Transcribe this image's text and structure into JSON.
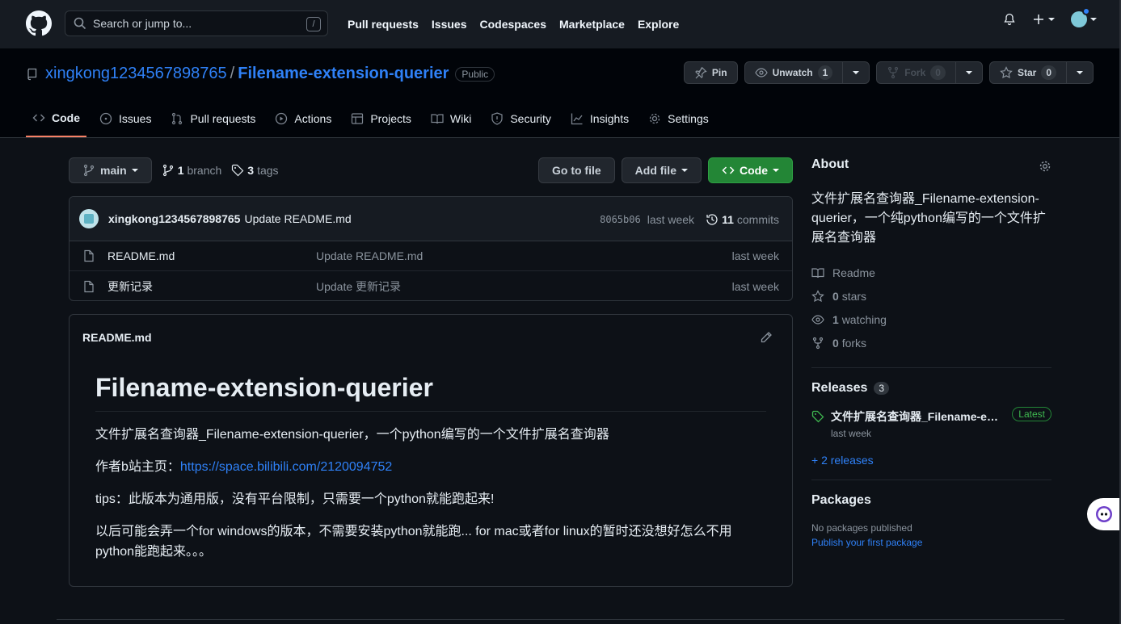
{
  "header": {
    "search_placeholder": "Search or jump to...",
    "search_shortcut": "/",
    "nav": [
      "Pull requests",
      "Issues",
      "Codespaces",
      "Marketplace",
      "Explore"
    ]
  },
  "repo": {
    "owner": "xingkong1234567898765",
    "separator": "/",
    "name": "Filename-extension-querier",
    "visibility": "Public",
    "actions": {
      "pin": "Pin",
      "unwatch": "Unwatch",
      "watch_count": "1",
      "fork": "Fork",
      "fork_count": "0",
      "star": "Star",
      "star_count": "0"
    },
    "tabs": [
      "Code",
      "Issues",
      "Pull requests",
      "Actions",
      "Projects",
      "Wiki",
      "Security",
      "Insights",
      "Settings"
    ]
  },
  "branchbar": {
    "branch": "main",
    "branch_count": "1",
    "branch_label": "branch",
    "tag_count": "3",
    "tag_label": "tags",
    "go_to_file": "Go to file",
    "add_file": "Add file",
    "code": "Code"
  },
  "commit": {
    "author": "xingkong1234567898765",
    "message": "Update README.md",
    "sha": "8065b06",
    "time": "last week",
    "commit_count": "11",
    "commit_label": "commits"
  },
  "files": [
    {
      "name": "README.md",
      "message": "Update README.md",
      "time": "last week"
    },
    {
      "name": "更新记录",
      "message": "Update 更新记录",
      "time": "last week"
    }
  ],
  "readme": {
    "filename": "README.md",
    "title": "Filename-extension-querier",
    "p1": "文件扩展名查询器_Filename-extension-querier，一个python编写的一个文件扩展名查询器",
    "p2_prefix": "作者b站主页：",
    "p2_link": "https://space.bilibili.com/2120094752",
    "p3": "tips：此版本为通用版，没有平台限制，只需要一个python就能跑起来!",
    "p4": "以后可能会弄一个for windows的版本，不需要安装python就能跑... for mac或者for linux的暂时还没想好怎么不用python能跑起来。。。"
  },
  "about": {
    "heading": "About",
    "description": "文件扩展名查询器_Filename-extension-querier，一个纯python编写的一个文件扩展名查询器",
    "readme": "Readme",
    "stars_count": "0",
    "stars_label": "stars",
    "watching_count": "1",
    "watching_label": "watching",
    "forks_count": "0",
    "forks_label": "forks"
  },
  "releases": {
    "heading": "Releases",
    "count": "3",
    "latest_name": "文件扩展名查询器_Filename-extension-querier",
    "latest_badge": "Latest",
    "latest_time": "last week",
    "more": "+ 2 releases"
  },
  "packages": {
    "heading": "Packages",
    "empty_text": "No packages published",
    "publish_link": "Publish your first package"
  },
  "colors": {
    "background": "#0d1117",
    "header": "#161b22",
    "link": "#2f81f7",
    "green": "#238636",
    "accent_underline": "#f78166"
  }
}
